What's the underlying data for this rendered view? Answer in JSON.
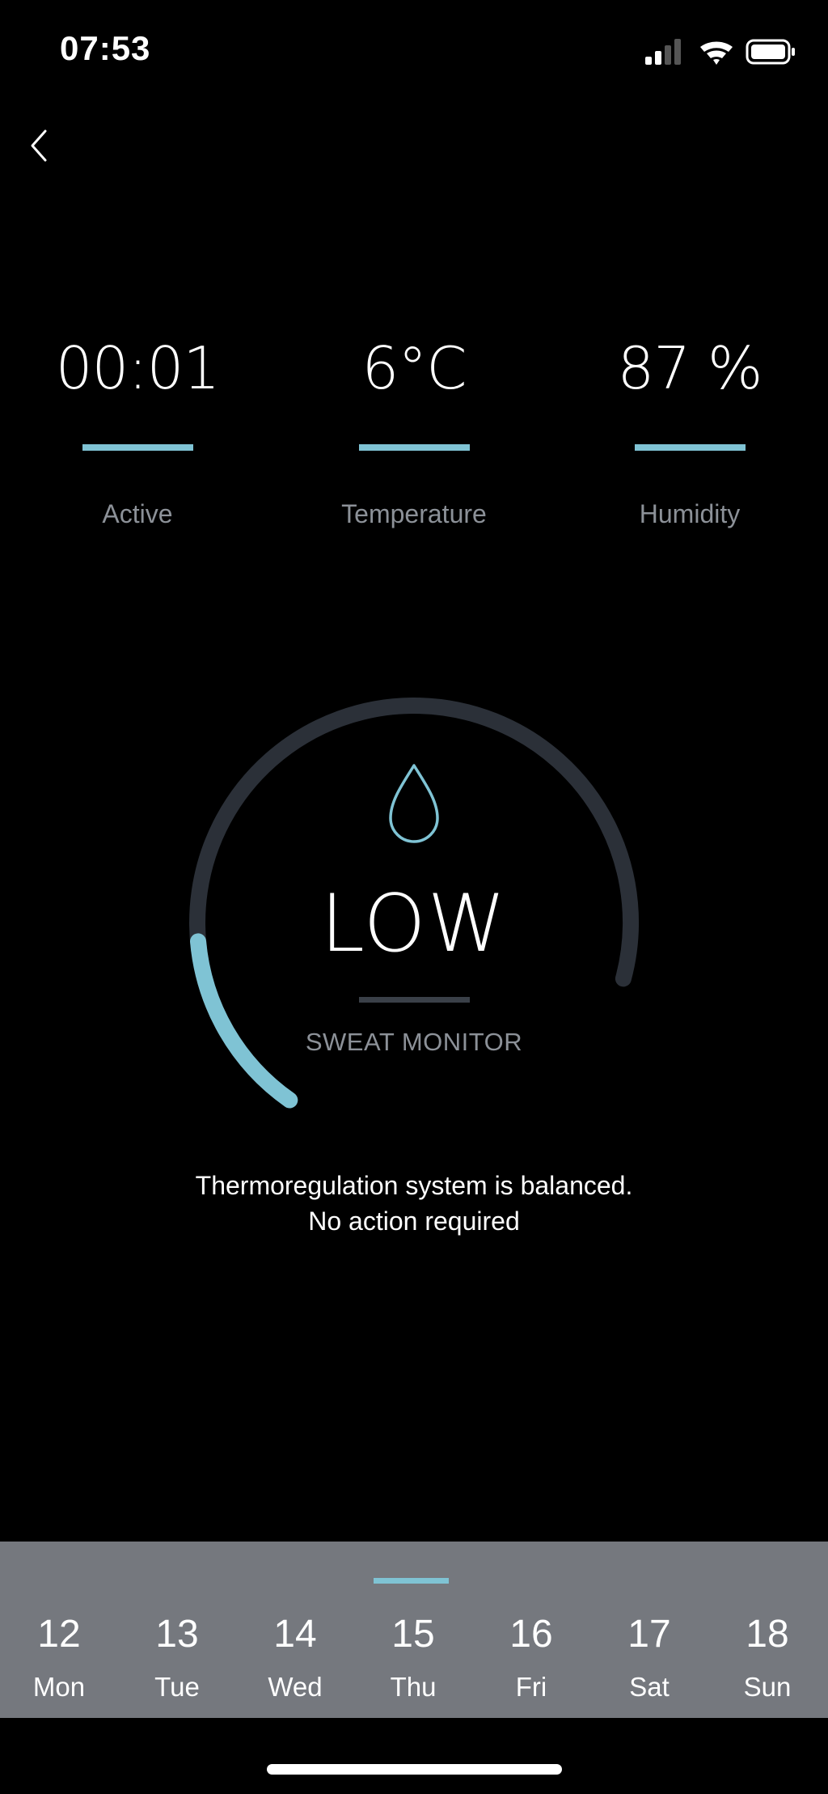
{
  "status_bar": {
    "time": "07:53",
    "icons": [
      "cellular-signal-icon",
      "wifi-icon",
      "battery-icon"
    ]
  },
  "navigation": {
    "back_icon": "chevron-left-icon"
  },
  "stats": [
    {
      "value": "00:01",
      "label": "Active"
    },
    {
      "value": "6°C",
      "label": "Temperature"
    },
    {
      "value": "87 %",
      "label": "Humidity"
    }
  ],
  "sweat_monitor": {
    "icon": "water-drop-icon",
    "level": "LOW",
    "label": "SWEAT MONITOR",
    "fill_fraction": 0.2
  },
  "message": {
    "line1": "Thermoregulation system is balanced.",
    "line2": "No action required"
  },
  "days": [
    {
      "num": "12",
      "name": "Mon"
    },
    {
      "num": "13",
      "name": "Tue"
    },
    {
      "num": "14",
      "name": "Wed"
    },
    {
      "num": "15",
      "name": "Thu"
    },
    {
      "num": "16",
      "name": "Fri"
    },
    {
      "num": "17",
      "name": "Sat"
    },
    {
      "num": "18",
      "name": "Sun"
    }
  ],
  "selected_day": "15",
  "colors": {
    "accent": "#7fc3d4",
    "background": "#000000",
    "track": "#2b3038",
    "day_strip": "#75787e",
    "muted_text": "#8c9198"
  }
}
